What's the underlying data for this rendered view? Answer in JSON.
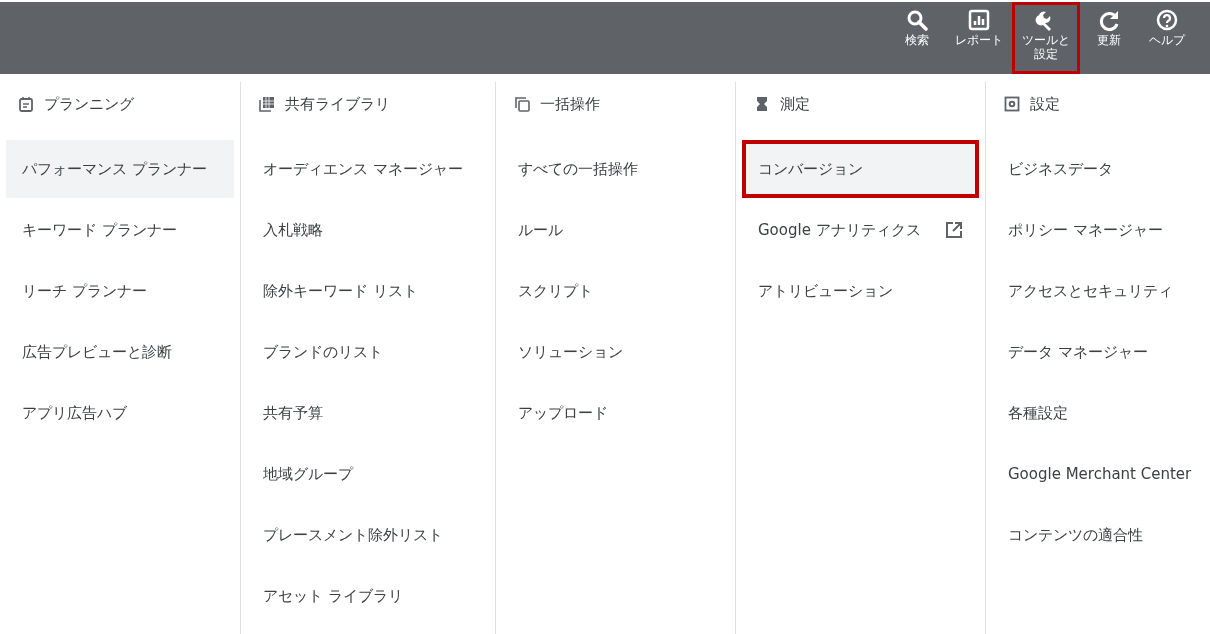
{
  "toolbar": {
    "buttons": [
      {
        "label": "検索",
        "highlighted": false
      },
      {
        "label": "レポート",
        "highlighted": false
      },
      {
        "label": "ツールと設定",
        "highlighted": true
      },
      {
        "label": "更新",
        "highlighted": false
      },
      {
        "label": "ヘルプ",
        "highlighted": false
      }
    ]
  },
  "columns": [
    {
      "title": "プランニング",
      "items": [
        {
          "label": "パフォーマンス プランナー",
          "selected": true,
          "highlighted": false,
          "external": false
        },
        {
          "label": "キーワード プランナー",
          "selected": false,
          "highlighted": false,
          "external": false
        },
        {
          "label": "リーチ プランナー",
          "selected": false,
          "highlighted": false,
          "external": false
        },
        {
          "label": "広告プレビューと診断",
          "selected": false,
          "highlighted": false,
          "external": false
        },
        {
          "label": "アプリ広告ハブ",
          "selected": false,
          "highlighted": false,
          "external": false
        }
      ]
    },
    {
      "title": "共有ライブラリ",
      "items": [
        {
          "label": "オーディエンス マネージャー",
          "selected": false,
          "highlighted": false,
          "external": false
        },
        {
          "label": "入札戦略",
          "selected": false,
          "highlighted": false,
          "external": false
        },
        {
          "label": "除外キーワード リスト",
          "selected": false,
          "highlighted": false,
          "external": false
        },
        {
          "label": "ブランドのリスト",
          "selected": false,
          "highlighted": false,
          "external": false
        },
        {
          "label": "共有予算",
          "selected": false,
          "highlighted": false,
          "external": false
        },
        {
          "label": "地域グループ",
          "selected": false,
          "highlighted": false,
          "external": false
        },
        {
          "label": "プレースメント除外リスト",
          "selected": false,
          "highlighted": false,
          "external": false
        },
        {
          "label": "アセット ライブラリ",
          "selected": false,
          "highlighted": false,
          "external": false
        }
      ]
    },
    {
      "title": "一括操作",
      "items": [
        {
          "label": "すべての一括操作",
          "selected": false,
          "highlighted": false,
          "external": false
        },
        {
          "label": "ルール",
          "selected": false,
          "highlighted": false,
          "external": false
        },
        {
          "label": "スクリプト",
          "selected": false,
          "highlighted": false,
          "external": false
        },
        {
          "label": "ソリューション",
          "selected": false,
          "highlighted": false,
          "external": false
        },
        {
          "label": "アップロード",
          "selected": false,
          "highlighted": false,
          "external": false
        }
      ]
    },
    {
      "title": "測定",
      "items": [
        {
          "label": "コンバージョン",
          "selected": true,
          "highlighted": true,
          "external": false
        },
        {
          "label": "Google アナリティクス",
          "selected": false,
          "highlighted": false,
          "external": true
        },
        {
          "label": "アトリビューション",
          "selected": false,
          "highlighted": false,
          "external": false
        }
      ]
    },
    {
      "title": "設定",
      "items": [
        {
          "label": "ビジネスデータ",
          "selected": false,
          "highlighted": false,
          "external": false
        },
        {
          "label": "ポリシー マネージャー",
          "selected": false,
          "highlighted": false,
          "external": false
        },
        {
          "label": "アクセスとセキュリティ",
          "selected": false,
          "highlighted": false,
          "external": false
        },
        {
          "label": "データ マネージャー",
          "selected": false,
          "highlighted": false,
          "external": false
        },
        {
          "label": "各種設定",
          "selected": false,
          "highlighted": false,
          "external": false
        },
        {
          "label": "Google Merchant Center",
          "selected": false,
          "highlighted": false,
          "external": false
        },
        {
          "label": "コンテンツの適合性",
          "selected": false,
          "highlighted": false,
          "external": false
        }
      ]
    }
  ]
}
